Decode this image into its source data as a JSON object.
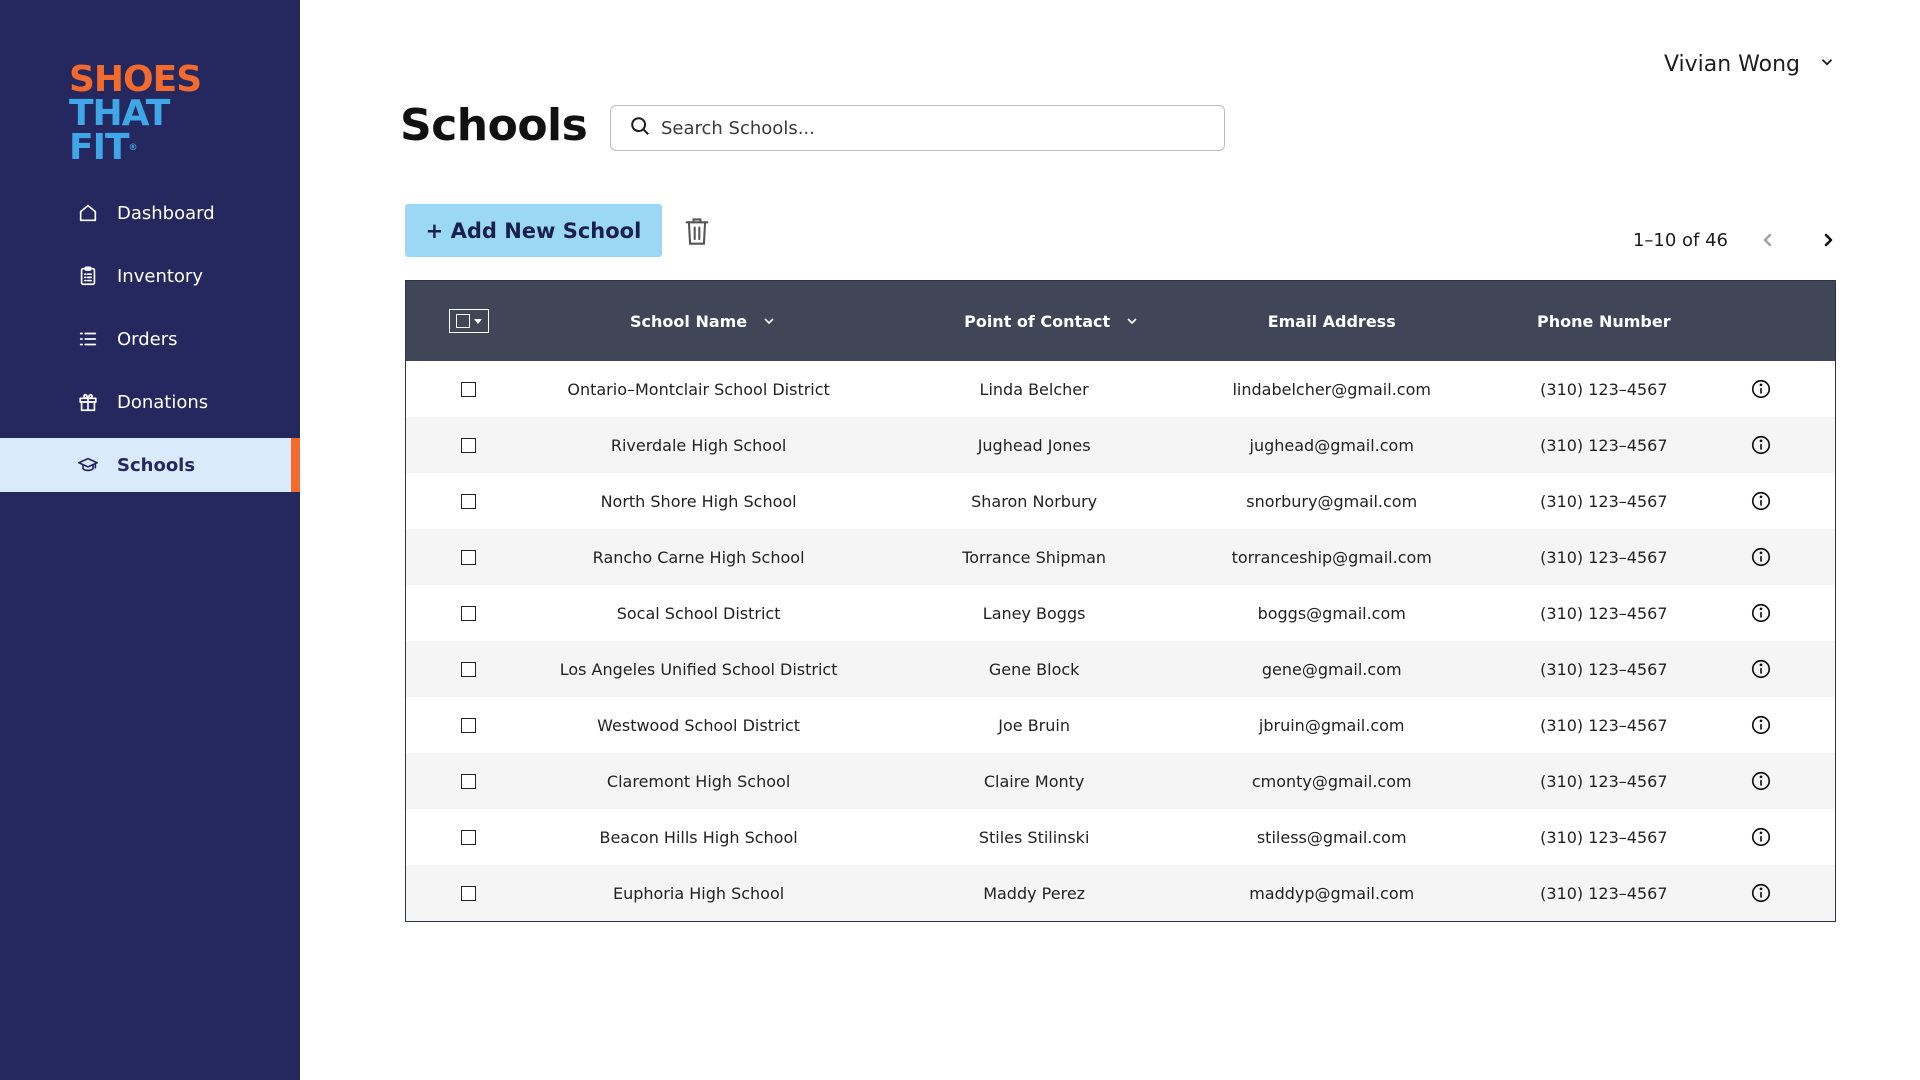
{
  "brand": {
    "line1": "SHOES",
    "line2": "THAT FIT",
    "mark": "®",
    "colors": {
      "primary": "#f26a2e",
      "secondary": "#3fa7e8",
      "sidebar": "#25275f"
    }
  },
  "sidebar": {
    "items": [
      {
        "label": "Dashboard",
        "icon": "home-icon"
      },
      {
        "label": "Inventory",
        "icon": "clipboard-icon"
      },
      {
        "label": "Orders",
        "icon": "list-icon"
      },
      {
        "label": "Donations",
        "icon": "gift-icon"
      },
      {
        "label": "Schools",
        "icon": "graduation-cap-icon",
        "active": true
      }
    ]
  },
  "header": {
    "user_name": "Vivian Wong"
  },
  "page": {
    "title": "Schools"
  },
  "search": {
    "placeholder": "Search Schools..."
  },
  "toolbar": {
    "add_label": "+ Add New School",
    "add_color": "#9ad8f5"
  },
  "pagination": {
    "label": "1–10 of 46"
  },
  "table": {
    "header_color": "#404658",
    "columns": {
      "name": "School Name",
      "contact": "Point of Contact",
      "email": "Email Address",
      "phone": "Phone Number"
    },
    "rows": [
      {
        "name": "Ontario–Montclair School District",
        "contact": "Linda Belcher",
        "email": "lindabelcher@gmail.com",
        "phone": "(310) 123–4567"
      },
      {
        "name": "Riverdale High School",
        "contact": "Jughead Jones",
        "email": "jughead@gmail.com",
        "phone": "(310) 123–4567"
      },
      {
        "name": "North Shore High School",
        "contact": "Sharon Norbury",
        "email": "snorbury@gmail.com",
        "phone": "(310) 123–4567"
      },
      {
        "name": "Rancho Carne High School",
        "contact": "Torrance Shipman",
        "email": "torranceship@gmail.com",
        "phone": "(310) 123–4567"
      },
      {
        "name": "Socal School District",
        "contact": "Laney Boggs",
        "email": "boggs@gmail.com",
        "phone": "(310) 123–4567"
      },
      {
        "name": "Los Angeles Unified School District",
        "contact": "Gene Block",
        "email": "gene@gmail.com",
        "phone": "(310) 123–4567"
      },
      {
        "name": "Westwood School District",
        "contact": "Joe Bruin",
        "email": "jbruin@gmail.com",
        "phone": "(310) 123–4567"
      },
      {
        "name": "Claremont High School",
        "contact": "Claire Monty",
        "email": "cmonty@gmail.com",
        "phone": "(310) 123–4567"
      },
      {
        "name": "Beacon Hills High School",
        "contact": "Stiles Stilinski",
        "email": "stiless@gmail.com",
        "phone": "(310) 123–4567"
      },
      {
        "name": "Euphoria High School",
        "contact": "Maddy Perez",
        "email": "maddyp@gmail.com",
        "phone": "(310) 123–4567"
      }
    ]
  }
}
